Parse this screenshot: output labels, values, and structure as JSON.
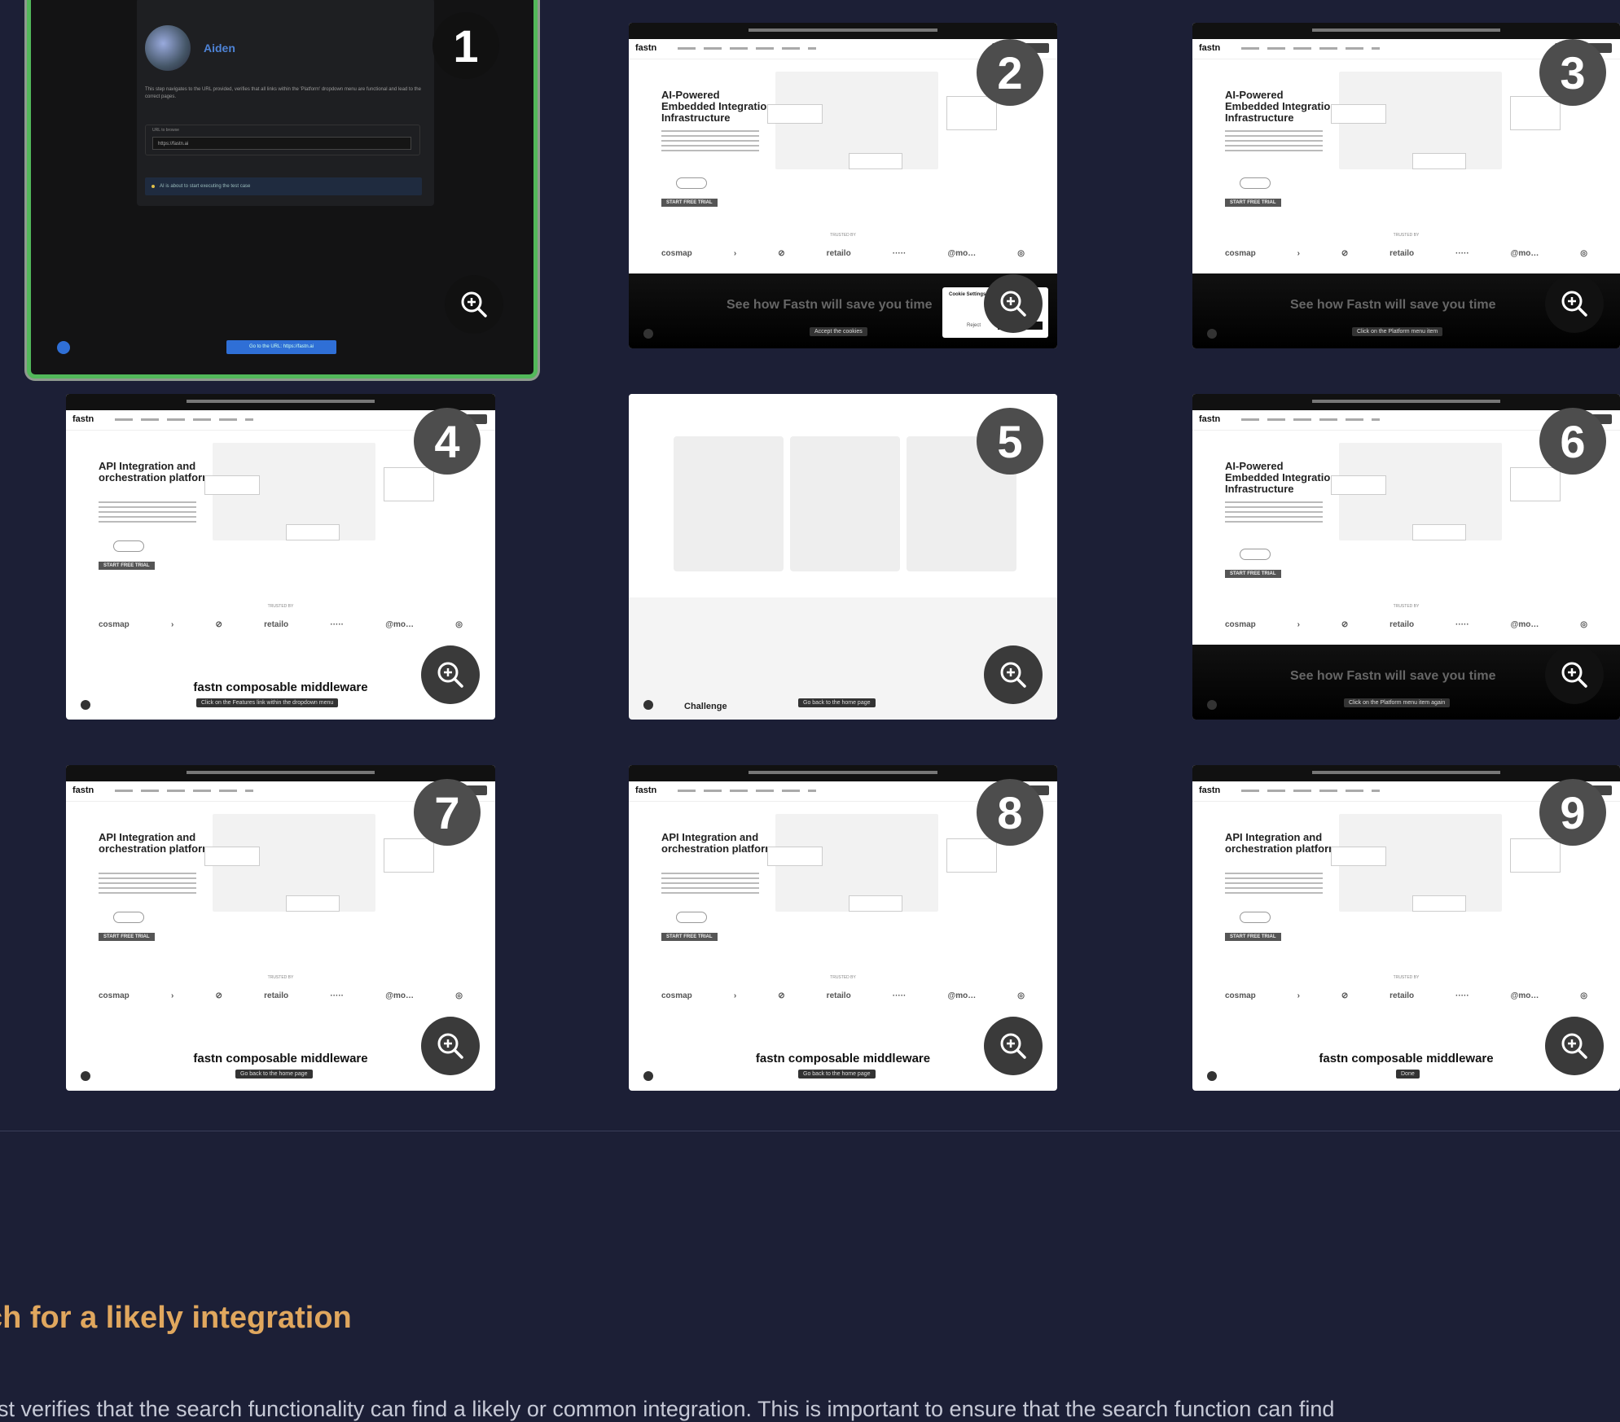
{
  "steps": [
    {
      "number": "1"
    },
    {
      "number": "2"
    },
    {
      "number": "3"
    },
    {
      "number": "4"
    },
    {
      "number": "5"
    },
    {
      "number": "6"
    },
    {
      "number": "7"
    },
    {
      "number": "8"
    },
    {
      "number": "9"
    }
  ],
  "card1": {
    "user_name": "Aiden",
    "description": "This step navigates to the URL provided, verifies that all links within the 'Platform' dropdown menu are functional and lead to the correct pages.",
    "field_label": "URL to browse",
    "field_value": "https://fastn.ai",
    "status_text": "AI is about to start executing the test case",
    "button_label": "Go to the URL: https://fastn.ai"
  },
  "mini": {
    "logo": "fastn",
    "hero_title_a": "AI-Powered Embedded Integration Infrastructure",
    "hero_title_b": "API Integration and orchestration platform",
    "cta": "START FREE TRIAL",
    "trusted": "TRUSTED BY",
    "logos": [
      "cosmap",
      "›",
      "⊘",
      "retailo",
      "·····",
      "@mo…",
      "◎"
    ],
    "dark_band": "See how Fastn will save you time",
    "middleware": "fastn composable middleware",
    "challenge": "Challenge"
  },
  "tooltips": {
    "t2": "Accept the cookies",
    "t3": "Click on the Platform menu item",
    "t4": "Click on the Features link within the dropdown menu",
    "t5": "Go back to the home page",
    "t6": "Click on the Platform menu item again",
    "t7": "Go back to the home page",
    "t8": "Go back to the home page",
    "t9": "Done"
  },
  "cookie": {
    "title": "Cookie Settings",
    "reject": "Reject",
    "accept": "Accept"
  },
  "section": {
    "heading": "ch for a likely integration",
    "description": "est verifies that the search functionality can find a likely or common integration. This is important to ensure that the search function can find"
  },
  "colors": {
    "background": "#1c1f36",
    "accent_heading": "#e0a75e",
    "selected_border": "#52b85a"
  },
  "icons": {
    "zoom": "zoom-in-icon"
  }
}
